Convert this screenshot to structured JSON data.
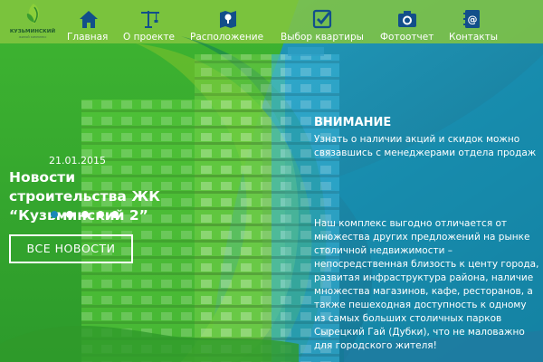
{
  "brand": {
    "name": "КУЗЬМИНСКИЙ",
    "tagline": "жилой комплекс"
  },
  "nav": {
    "items": [
      {
        "label": "Главная",
        "icon": "house-icon"
      },
      {
        "label": "О проекте",
        "icon": "crane-icon"
      },
      {
        "label": "Расположение",
        "icon": "map-pin-icon"
      },
      {
        "label": "Выбор квартиры",
        "icon": "checkbox-icon"
      },
      {
        "label": "Фотоотчет",
        "icon": "camera-icon"
      },
      {
        "label": "Контакты",
        "icon": "address-book-icon"
      }
    ]
  },
  "news": {
    "date": "21.01.2015",
    "title": "Новости строительства ЖК “Кузьминский 2”",
    "slides": 5,
    "active_slide": 1,
    "all_news_label": "ВСЕ НОВОСТИ"
  },
  "attention": {
    "title": "ВНИМАНИЕ",
    "text": "Узнать о наличии акций и скидок можно связавшись с менеджерами отдела продаж"
  },
  "about": {
    "text": "Наш комплекс выгодно отличается от множества других предложений на рынке столичной недвижимости – непосредственная близость к центу города, развитая инфраструктура района, наличие множества магазинов, кафе, ресторанов, а также пешеходная доступность к одному из самых больших столичных парков Сырецкий Гай (Дубки), что не маловажно для городского жителя!"
  },
  "colors": {
    "green": "#3aa832",
    "lime": "#78c62f",
    "teal": "#1d8ea8",
    "dark_teal": "#0f6a86",
    "accent_dot": "#1a88b8"
  }
}
